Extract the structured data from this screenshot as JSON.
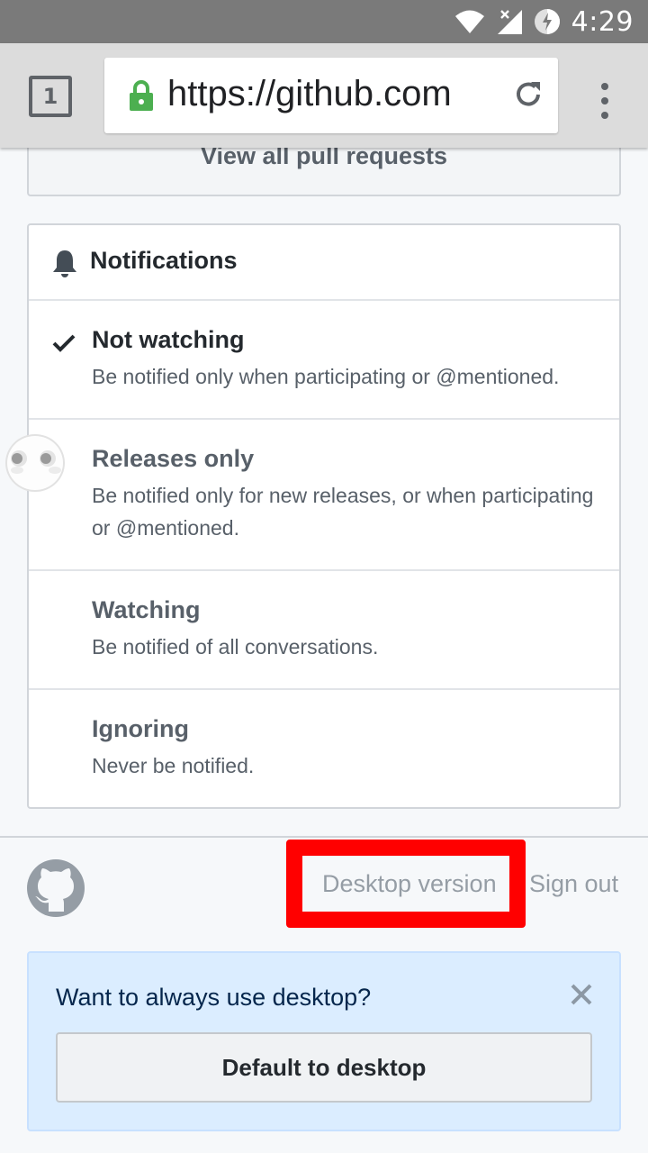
{
  "status_bar": {
    "time": "4:29",
    "icons": [
      "wifi-icon",
      "no-signal-icon",
      "battery-charging-icon"
    ]
  },
  "browser": {
    "tab_count": "1",
    "url": "https://github.com",
    "icons": [
      "lock-icon",
      "reload-icon",
      "more-vert-icon"
    ],
    "secure_color": "#4caf50"
  },
  "pull_requests": {
    "view_all_label": "View all pull requests"
  },
  "notifications": {
    "title": "Notifications",
    "options": [
      {
        "title": "Not watching",
        "description": "Be notified only when participating or @mentioned.",
        "selected": true
      },
      {
        "title": "Releases only",
        "description": "Be notified only for new releases, or when participating or @mentioned.",
        "selected": false
      },
      {
        "title": "Watching",
        "description": "Be notified of all conversations.",
        "selected": false
      },
      {
        "title": "Ignoring",
        "description": "Never be notified.",
        "selected": false
      }
    ]
  },
  "footer": {
    "logo": "github-octocat-icon",
    "desktop_version_label": "Desktop version",
    "sign_out_label": "Sign out",
    "highlight_color": "#ff0000"
  },
  "desktop_prompt": {
    "question": "Want to always use desktop?",
    "default_button_label": "Default to desktop",
    "close_icon": "close-icon"
  }
}
